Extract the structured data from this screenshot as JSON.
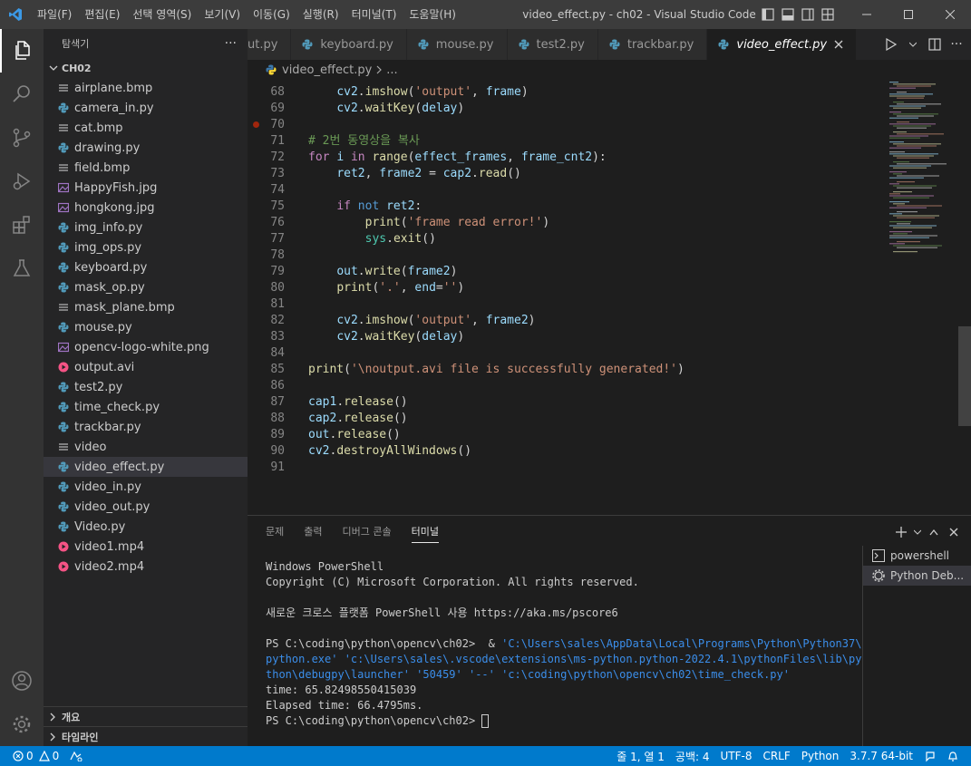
{
  "window": {
    "title": "video_effect.py - ch02 - Visual Studio Code",
    "menu": [
      "파일(F)",
      "편집(E)",
      "선택 영역(S)",
      "보기(V)",
      "이동(G)",
      "실행(R)",
      "터미널(T)",
      "도움말(H)"
    ]
  },
  "sidebar": {
    "header": "탐색기",
    "more": "···",
    "folder": "CH02",
    "files": [
      {
        "name": "airplane.bmp",
        "icon": "lines-icon"
      },
      {
        "name": "camera_in.py",
        "icon": "python-icon"
      },
      {
        "name": "cat.bmp",
        "icon": "lines-icon"
      },
      {
        "name": "drawing.py",
        "icon": "python-icon"
      },
      {
        "name": "field.bmp",
        "icon": "lines-icon"
      },
      {
        "name": "HappyFish.jpg",
        "icon": "image-icon"
      },
      {
        "name": "hongkong.jpg",
        "icon": "image-icon"
      },
      {
        "name": "img_info.py",
        "icon": "python-icon"
      },
      {
        "name": "img_ops.py",
        "icon": "python-icon"
      },
      {
        "name": "keyboard.py",
        "icon": "python-icon"
      },
      {
        "name": "mask_op.py",
        "icon": "python-icon"
      },
      {
        "name": "mask_plane.bmp",
        "icon": "lines-icon"
      },
      {
        "name": "mouse.py",
        "icon": "python-icon"
      },
      {
        "name": "opencv-logo-white.png",
        "icon": "image-icon"
      },
      {
        "name": "output.avi",
        "icon": "video-icon"
      },
      {
        "name": "test2.py",
        "icon": "python-icon"
      },
      {
        "name": "time_check.py",
        "icon": "python-icon"
      },
      {
        "name": "trackbar.py",
        "icon": "python-icon"
      },
      {
        "name": "video",
        "icon": "lines-icon"
      },
      {
        "name": "video_effect.py",
        "icon": "python-icon"
      },
      {
        "name": "video_in.py",
        "icon": "python-icon"
      },
      {
        "name": "video_out.py",
        "icon": "python-icon"
      },
      {
        "name": "Video.py",
        "icon": "python-icon"
      },
      {
        "name": "video1.mp4",
        "icon": "video-icon"
      },
      {
        "name": "video2.mp4",
        "icon": "video-icon"
      }
    ],
    "selected_file": "video_effect.py",
    "sections": [
      "개요",
      "타임라인"
    ]
  },
  "tabs": [
    {
      "label": "ut.py",
      "active": false
    },
    {
      "label": "keyboard.py",
      "active": false
    },
    {
      "label": "mouse.py",
      "active": false
    },
    {
      "label": "test2.py",
      "active": false
    },
    {
      "label": "trackbar.py",
      "active": false
    },
    {
      "label": "video_effect.py",
      "active": true
    }
  ],
  "breadcrumb": {
    "file": "video_effect.py",
    "rest": "..."
  },
  "editor": {
    "breakpoint_line": 70,
    "lines": [
      {
        "n": 68,
        "html": "    <span class=\"var\">cv2</span>.<span class=\"fn\">imshow</span>(<span class=\"str\">'output'</span>, <span class=\"var\">frame</span>)"
      },
      {
        "n": 69,
        "html": "    <span class=\"var\">cv2</span>.<span class=\"fn\">waitKey</span>(<span class=\"var\">delay</span>)"
      },
      {
        "n": 70,
        "html": ""
      },
      {
        "n": 71,
        "html": "<span class=\"com\"># 2번 동영상을 복사</span>"
      },
      {
        "n": 72,
        "html": "<span class=\"kw\">for</span> <span class=\"var\">i</span> <span class=\"kw\">in</span> <span class=\"fn\">range</span>(<span class=\"var\">effect_frames</span>, <span class=\"var\">frame_cnt2</span>):"
      },
      {
        "n": 73,
        "html": "    <span class=\"var\">ret2</span>, <span class=\"var\">frame2</span> = <span class=\"var\">cap2</span>.<span class=\"fn\">read</span>()"
      },
      {
        "n": 74,
        "html": ""
      },
      {
        "n": 75,
        "html": "    <span class=\"kw\">if</span> <span class=\"blue\">not</span> <span class=\"var\">ret2</span>:"
      },
      {
        "n": 76,
        "html": "        <span class=\"fn\">print</span>(<span class=\"str\">'frame read error!'</span>)"
      },
      {
        "n": 77,
        "html": "        <span class=\"cls\">sys</span>.<span class=\"fn\">exit</span>()"
      },
      {
        "n": 78,
        "html": ""
      },
      {
        "n": 79,
        "html": "    <span class=\"var\">out</span>.<span class=\"fn\">write</span>(<span class=\"var\">frame2</span>)"
      },
      {
        "n": 80,
        "html": "    <span class=\"fn\">print</span>(<span class=\"str\">'.'</span>, <span class=\"var\">end</span>=<span class=\"str\">''</span>)"
      },
      {
        "n": 81,
        "html": ""
      },
      {
        "n": 82,
        "html": "    <span class=\"var\">cv2</span>.<span class=\"fn\">imshow</span>(<span class=\"str\">'output'</span>, <span class=\"var\">frame2</span>)"
      },
      {
        "n": 83,
        "html": "    <span class=\"var\">cv2</span>.<span class=\"fn\">waitKey</span>(<span class=\"var\">delay</span>)"
      },
      {
        "n": 84,
        "html": ""
      },
      {
        "n": 85,
        "html": "<span class=\"fn\">print</span>(<span class=\"str\">'\\noutput.avi file is successfully generated!'</span>)"
      },
      {
        "n": 86,
        "html": ""
      },
      {
        "n": 87,
        "html": "<span class=\"var\">cap1</span>.<span class=\"fn\">release</span>()"
      },
      {
        "n": 88,
        "html": "<span class=\"var\">cap2</span>.<span class=\"fn\">release</span>()"
      },
      {
        "n": 89,
        "html": "<span class=\"var\">out</span>.<span class=\"fn\">release</span>()"
      },
      {
        "n": 90,
        "html": "<span class=\"var\">cv2</span>.<span class=\"fn\">destroyAllWindows</span>()"
      },
      {
        "n": 91,
        "html": ""
      }
    ]
  },
  "panel": {
    "tabs": [
      "문제",
      "출력",
      "디버그 콘솔",
      "터미널"
    ],
    "active_tab": "터미널",
    "terminal_lines": [
      {
        "text": "Windows PowerShell",
        "kind": "plain"
      },
      {
        "text": "Copyright (C) Microsoft Corporation. All rights reserved.",
        "kind": "plain"
      },
      {
        "text": "",
        "kind": "plain"
      },
      {
        "text": "새로운 크로스 플랫폼 PowerShell 사용 https://aka.ms/pscore6",
        "kind": "plain"
      },
      {
        "text": "",
        "kind": "plain"
      },
      {
        "prompt": "PS C:\\coding\\python\\opencv\\ch02>  & ",
        "path": "'C:\\Users\\sales\\AppData\\Local\\Programs\\Python\\Python37\\",
        "kind": "cmd"
      },
      {
        "text": "python.exe' 'c:\\Users\\sales\\.vscode\\extensions\\ms-python.python-2022.4.1\\pythonFiles\\lib\\py",
        "kind": "path"
      },
      {
        "text": "thon\\debugpy\\launcher' '50459' '--' 'c:\\coding\\python\\opencv\\ch02\\time_check.py'",
        "kind": "path"
      },
      {
        "text": "time: 65.82498550415039",
        "kind": "plain"
      },
      {
        "text": "Elapsed time: 66.4795ms.",
        "kind": "plain"
      },
      {
        "text": "PS C:\\coding\\python\\opencv\\ch02> ",
        "kind": "prompt"
      }
    ],
    "terminal_list": [
      {
        "label": "powershell",
        "icon": "terminal-icon",
        "active": false
      },
      {
        "label": "Python Deb...",
        "icon": "debug-gear-icon",
        "active": true
      }
    ]
  },
  "statusbar": {
    "errors": "0",
    "warnings": "0",
    "right": [
      "줄 1, 열 1",
      "공백: 4",
      "UTF-8",
      "CRLF",
      "Python",
      "3.7.7 64-bit"
    ]
  },
  "colors": {
    "accent": "#007acc",
    "titlebar": "#3c3c3c",
    "sidebar": "#252526",
    "editor": "#1e1e1e"
  }
}
